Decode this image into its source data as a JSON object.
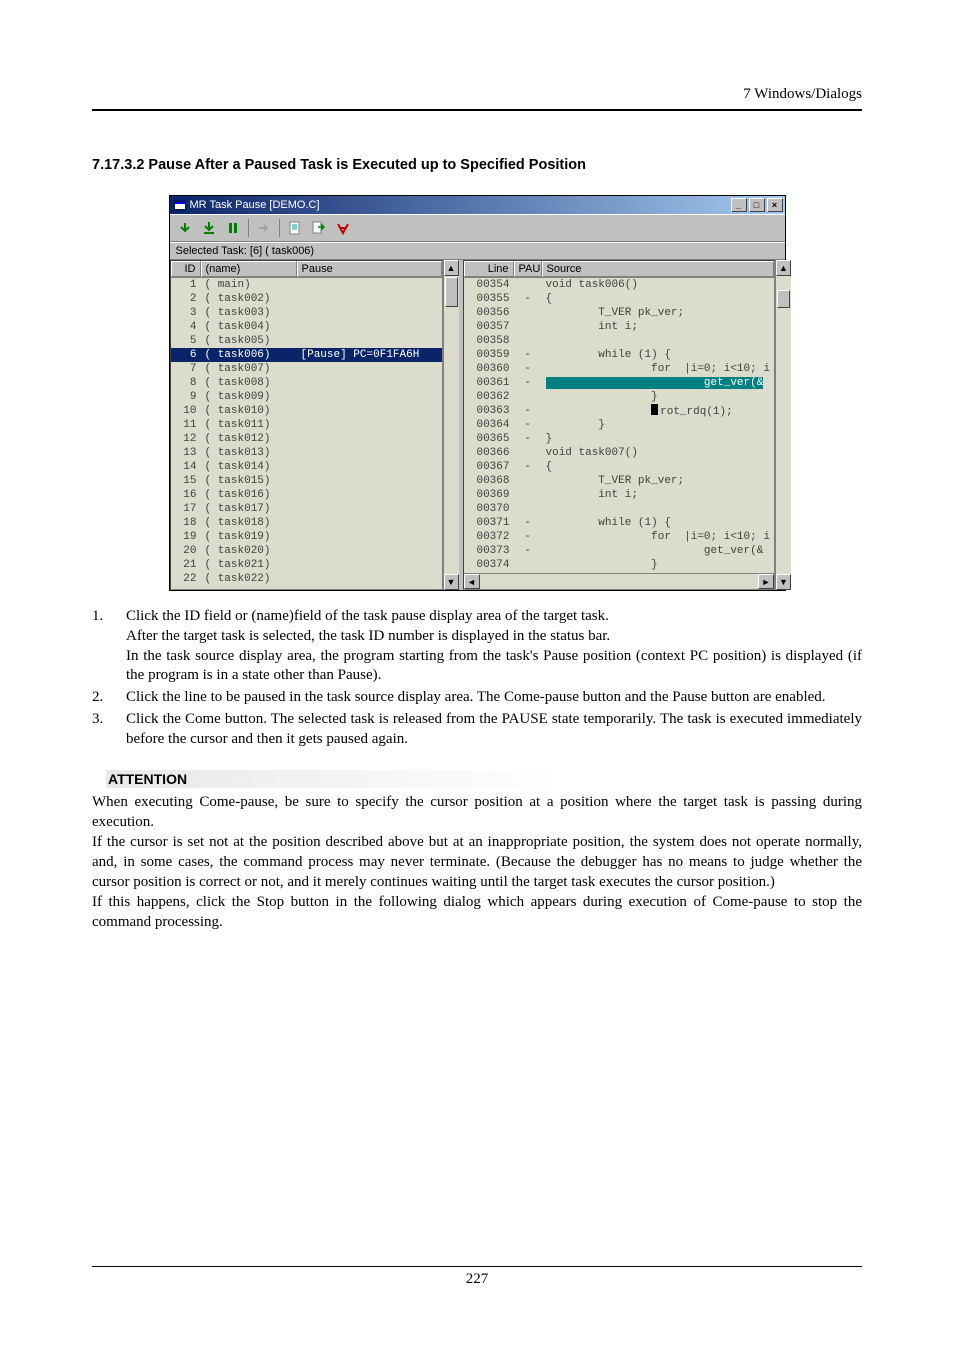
{
  "header_right": "7  Windows/Dialogs",
  "section_heading": "7.17.3.2 Pause After a Paused Task is Executed up to Specified Position",
  "window": {
    "title": "MR Task Pause [DEMO.C]",
    "status_bar": "Selected Task: [6] ( task006)",
    "left_headers": {
      "id": "ID",
      "name": "(name)",
      "pause": "Pause"
    },
    "right_headers": {
      "line": "Line",
      "pau": "PAU",
      "source": "Source"
    },
    "task_rows": [
      {
        "id": "1",
        "name": "(    main)",
        "pause": ""
      },
      {
        "id": "2",
        "name": "( task002)",
        "pause": ""
      },
      {
        "id": "3",
        "name": "( task003)",
        "pause": ""
      },
      {
        "id": "4",
        "name": "( task004)",
        "pause": ""
      },
      {
        "id": "5",
        "name": "( task005)",
        "pause": ""
      },
      {
        "id": "6",
        "name": "( task006)",
        "pause": "[Pause] PC=0F1FA6H",
        "selected": true
      },
      {
        "id": "7",
        "name": "( task007)",
        "pause": ""
      },
      {
        "id": "8",
        "name": "( task008)",
        "pause": ""
      },
      {
        "id": "9",
        "name": "( task009)",
        "pause": ""
      },
      {
        "id": "10",
        "name": "( task010)",
        "pause": ""
      },
      {
        "id": "11",
        "name": "( task011)",
        "pause": ""
      },
      {
        "id": "12",
        "name": "( task012)",
        "pause": ""
      },
      {
        "id": "13",
        "name": "( task013)",
        "pause": ""
      },
      {
        "id": "14",
        "name": "( task014)",
        "pause": ""
      },
      {
        "id": "15",
        "name": "( task015)",
        "pause": ""
      },
      {
        "id": "16",
        "name": "( task016)",
        "pause": ""
      },
      {
        "id": "17",
        "name": "( task017)",
        "pause": ""
      },
      {
        "id": "18",
        "name": "( task018)",
        "pause": ""
      },
      {
        "id": "19",
        "name": "( task019)",
        "pause": ""
      },
      {
        "id": "20",
        "name": "( task020)",
        "pause": ""
      },
      {
        "id": "21",
        "name": "( task021)",
        "pause": ""
      },
      {
        "id": "22",
        "name": "( task022)",
        "pause": ""
      }
    ],
    "source_rows": [
      {
        "line": "00354",
        "pau": "",
        "src": "void task006()"
      },
      {
        "line": "00355",
        "pau": "-",
        "src": "{"
      },
      {
        "line": "00356",
        "pau": "",
        "src": "        T_VER pk_ver;"
      },
      {
        "line": "00357",
        "pau": "",
        "src": "        int i;"
      },
      {
        "line": "00358",
        "pau": "",
        "src": ""
      },
      {
        "line": "00359",
        "pau": "-",
        "src": "        while (1) {"
      },
      {
        "line": "00360",
        "pau": "-",
        "src": "                for  |i=0; i<10; i"
      },
      {
        "line": "00361",
        "pau": "-",
        "src": "                        get_ver(&",
        "highlight": true
      },
      {
        "line": "00362",
        "pau": "",
        "src": "                }"
      },
      {
        "line": "00363",
        "pau": "-",
        "src": "                rot_rdq(1);",
        "cursor": true
      },
      {
        "line": "00364",
        "pau": "-",
        "src": "        }"
      },
      {
        "line": "00365",
        "pau": "-",
        "src": "}"
      },
      {
        "line": "00366",
        "pau": "",
        "src": "void task007()"
      },
      {
        "line": "00367",
        "pau": "-",
        "src": "{"
      },
      {
        "line": "00368",
        "pau": "",
        "src": "        T_VER pk_ver;"
      },
      {
        "line": "00369",
        "pau": "",
        "src": "        int i;"
      },
      {
        "line": "00370",
        "pau": "",
        "src": ""
      },
      {
        "line": "00371",
        "pau": "-",
        "src": "        while (1) {"
      },
      {
        "line": "00372",
        "pau": "-",
        "src": "                for  |i=0; i<10; i"
      },
      {
        "line": "00373",
        "pau": "-",
        "src": "                        get_ver(&"
      },
      {
        "line": "00374",
        "pau": "",
        "src": "                }"
      }
    ]
  },
  "ol": [
    {
      "n": "1.",
      "lines": [
        "Click the ID field or (name)field of the task pause display area of the target task.",
        "After the target task is selected, the task ID number is displayed in the status bar.",
        "In the task source display area, the program starting from the task's Pause position (context PC position) is displayed (if the program is in a state other than Pause)."
      ]
    },
    {
      "n": "2.",
      "lines": [
        "Click the line to be paused in the task source display area. The Come-pause button and the Pause button are enabled."
      ]
    },
    {
      "n": "3.",
      "lines": [
        "Click the Come button. The selected task is released from the PAUSE state temporarily. The task is executed immediately before the cursor and then it gets paused again."
      ]
    }
  ],
  "attention_heading": "ATTENTION",
  "attention_paras": [
    "When executing Come-pause, be sure to specify the cursor position at a position where the target task is passing during execution.",
    "If the cursor is set not at the position described above but at an inappropriate position, the system does not operate normally, and, in some cases, the command process may never terminate. (Because the debugger has no means to judge whether the cursor position is correct or not, and it merely continues waiting until the target task executes the cursor position.)",
    "If this happens, click the Stop button in the following dialog which appears during execution of Come-pause to stop the command processing."
  ],
  "page_number": "227"
}
